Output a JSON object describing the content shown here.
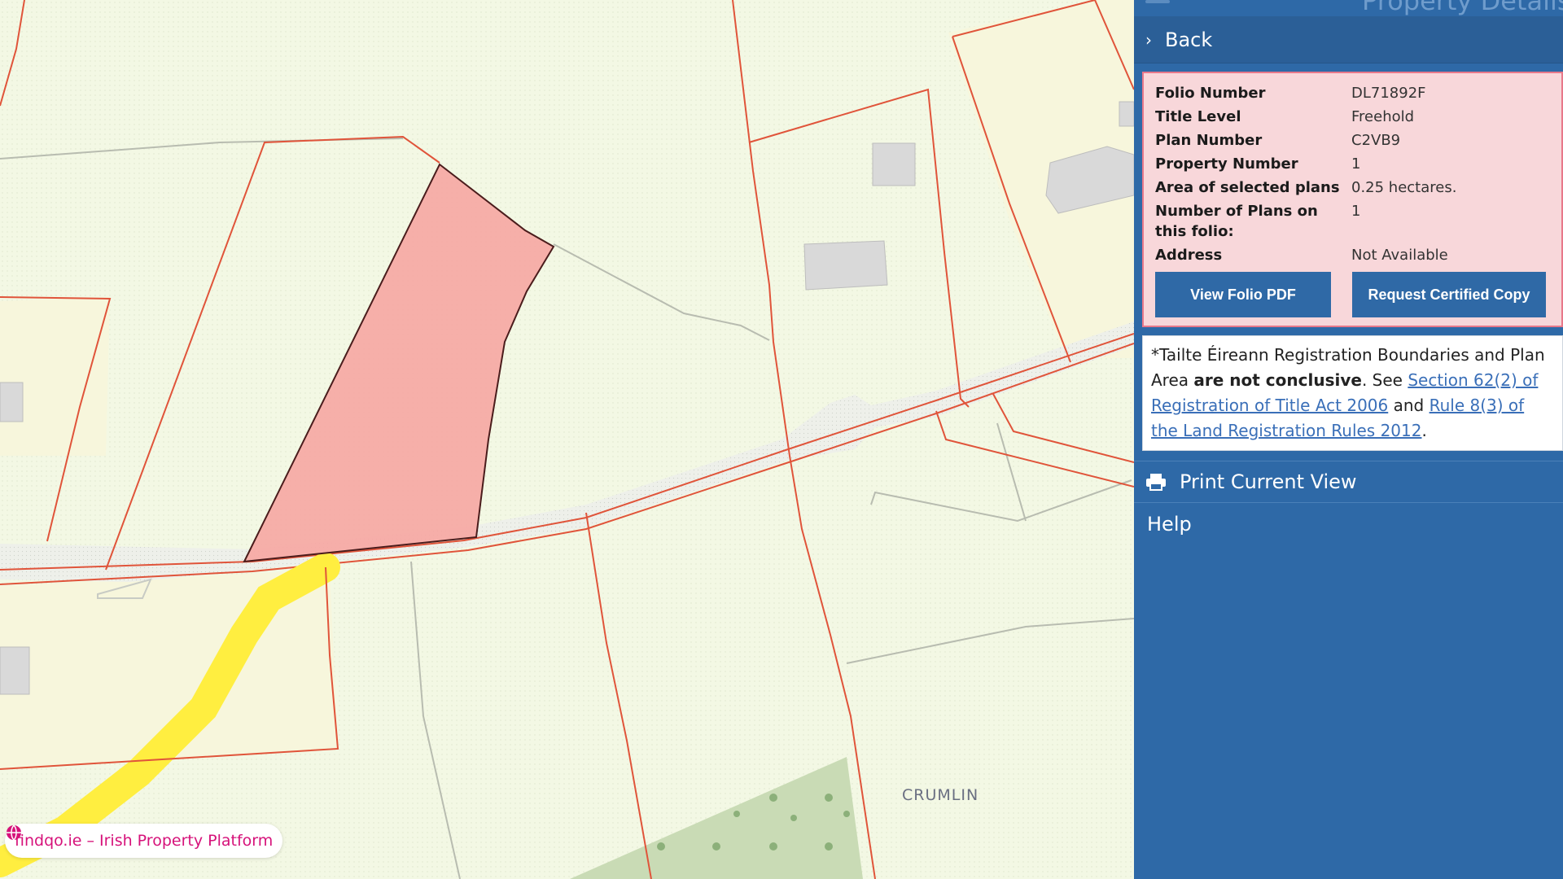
{
  "map": {
    "place_label": "CRUMLIN",
    "brand_text": "findqo.ie – Irish Property Platform",
    "colors": {
      "background": "#f3f8e4",
      "boundary": "#e0543a",
      "selected_fill": "#f6a6a2",
      "road": "#ffee40"
    }
  },
  "panel": {
    "header_title": "Property Details",
    "back_label": "Back",
    "details": [
      {
        "key": "Folio Number",
        "value": "DL71892F"
      },
      {
        "key": "Title Level",
        "value": "Freehold"
      },
      {
        "key": "Plan Number",
        "value": "C2VB9"
      },
      {
        "key": "Property Number",
        "value": "1"
      },
      {
        "key": "Area of selected plans",
        "value": "0.25 hectares."
      },
      {
        "key": "Number of Plans on this folio:",
        "value": "1"
      },
      {
        "key": "Address",
        "value": "Not Available"
      }
    ],
    "buttons": {
      "pdf": "View Folio PDF",
      "copy": "Request Certified Copy"
    },
    "notice": {
      "part1": "*Tailte Éireann Registration Boundaries and Plan Area ",
      "bold": "are not conclusive",
      "part2": ". See ",
      "link1": "Section 62(2) of Registration of Title Act 2006",
      "part3": " and ",
      "link2": "Rule 8(3) of the Land Registration Rules 2012",
      "part4": "."
    },
    "print_label": "Print Current View",
    "help_label": "Help",
    "colors": {
      "panel": "#2e69a7",
      "details_bg": "#f8d7da",
      "details_border": "#e8788a"
    }
  }
}
